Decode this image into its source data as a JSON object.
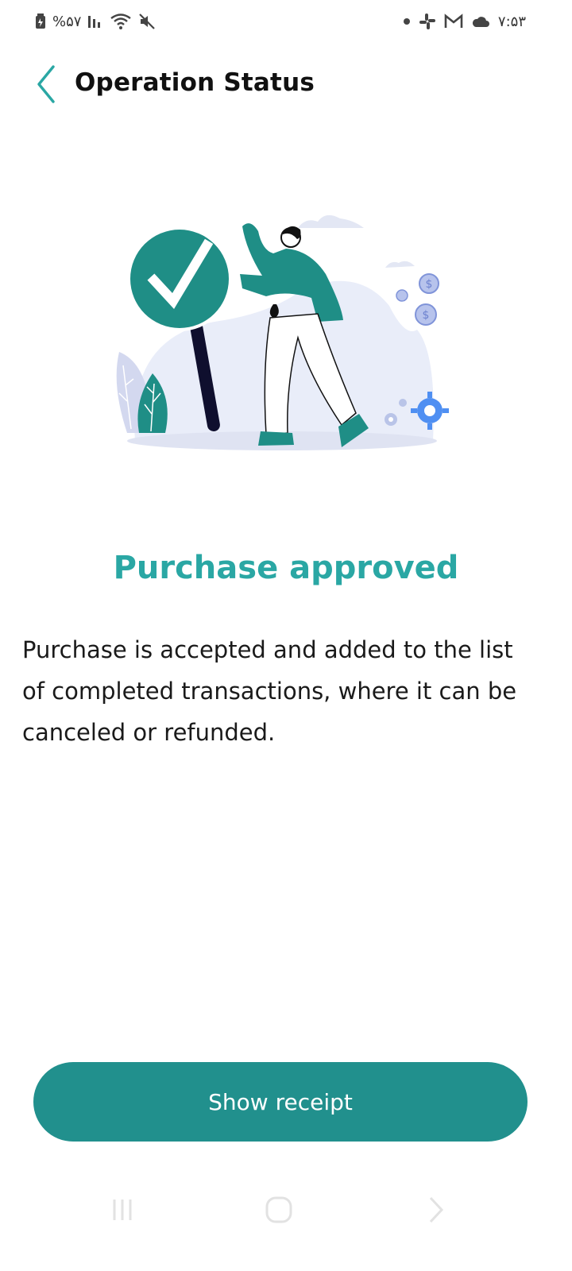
{
  "status_bar": {
    "battery_text": "%۵۷",
    "time": "۷:۵۳",
    "left_icons": [
      "battery-icon",
      "signal-icon",
      "wifi-icon",
      "mute-icon"
    ],
    "right_icons": [
      "notification-dot-icon",
      "slack-icon",
      "gmail-icon",
      "cloud-icon"
    ]
  },
  "header": {
    "title": "Operation Status",
    "back_icon": "chevron-left-icon"
  },
  "result": {
    "title": "Purchase approved",
    "description": "Purchase is accepted and added to the list of completed transactions, where it can be canceled or refunded."
  },
  "actions": {
    "show_receipt_label": "Show receipt"
  },
  "nav_bar": {
    "icons": [
      "recents-icon",
      "home-icon",
      "back-icon"
    ]
  },
  "colors": {
    "accent": "#2aa7a4",
    "button": "#21908d",
    "illustration_teal": "#1f8e86",
    "illustration_blob": "#e9edf9"
  }
}
